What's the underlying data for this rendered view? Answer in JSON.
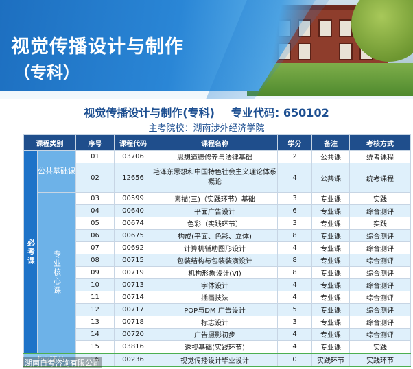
{
  "banner": {
    "title": "视觉传播设计与制作",
    "subtitle": "（专科）"
  },
  "heading": {
    "program": "视觉传播设计与制作(专科)",
    "code_label": "专业代码:",
    "code": "650102",
    "school": "主考院校：湖南涉外经济学院"
  },
  "table": {
    "headers": [
      "课程类别",
      "序号",
      "课程代码",
      "课程名称",
      "学分",
      "备注",
      "考核方式"
    ],
    "group": "必考课",
    "sub_public": "公共基础课",
    "sub_core": "专业核心课",
    "sub_grad": "毕业环节",
    "rows": [
      {
        "no": "01",
        "code": "03706",
        "name": "思想道德修养与法律基础",
        "credit": "2",
        "note": "公共课",
        "exam": "统考课程"
      },
      {
        "no": "02",
        "code": "12656",
        "name": "毛泽东思想和中国特色社会主义理论体系概论",
        "credit": "4",
        "note": "公共课",
        "exam": "统考课程"
      },
      {
        "no": "03",
        "code": "00599",
        "name": "素描(三)（实践环节）基础",
        "credit": "3",
        "note": "专业课",
        "exam": "实践"
      },
      {
        "no": "04",
        "code": "00640",
        "name": "平面广告设计",
        "credit": "6",
        "note": "专业课",
        "exam": "综合测评"
      },
      {
        "no": "05",
        "code": "00674",
        "name": "色彩（实践环节）",
        "credit": "3",
        "note": "专业课",
        "exam": "实践"
      },
      {
        "no": "06",
        "code": "00675",
        "name": "构成(平面、色彩、立体)",
        "credit": "8",
        "note": "专业课",
        "exam": "综合测评"
      },
      {
        "no": "07",
        "code": "00692",
        "name": "计算机辅助图形设计",
        "credit": "4",
        "note": "专业课",
        "exam": "综合测评"
      },
      {
        "no": "08",
        "code": "00715",
        "name": "包装结构与包装装潢设计",
        "credit": "8",
        "note": "专业课",
        "exam": "综合测评"
      },
      {
        "no": "09",
        "code": "00719",
        "name": "机构形象设计(VI)",
        "credit": "8",
        "note": "专业课",
        "exam": "综合测评"
      },
      {
        "no": "10",
        "code": "00713",
        "name": "字体设计",
        "credit": "4",
        "note": "专业课",
        "exam": "综合测评"
      },
      {
        "no": "11",
        "code": "00714",
        "name": "插画技法",
        "credit": "4",
        "note": "专业课",
        "exam": "综合测评"
      },
      {
        "no": "12",
        "code": "00717",
        "name": "POP与DM 广告设计",
        "credit": "5",
        "note": "专业课",
        "exam": "综合测评"
      },
      {
        "no": "13",
        "code": "00718",
        "name": "标志设计",
        "credit": "3",
        "note": "专业课",
        "exam": "综合测评"
      },
      {
        "no": "14",
        "code": "00720",
        "name": "广告摄影初步",
        "credit": "4",
        "note": "专业课",
        "exam": "综合测评"
      },
      {
        "no": "15",
        "code": "03816",
        "name": "透视基础(实践环节)",
        "credit": "4",
        "note": "专业课",
        "exam": "实践"
      },
      {
        "no": "16",
        "code": "00236",
        "name": "视觉传播设计毕业设计",
        "credit": "0",
        "note": "实践环节",
        "exam": "实践环节"
      }
    ]
  },
  "watermark": "湖南自考咨询有限公司"
}
